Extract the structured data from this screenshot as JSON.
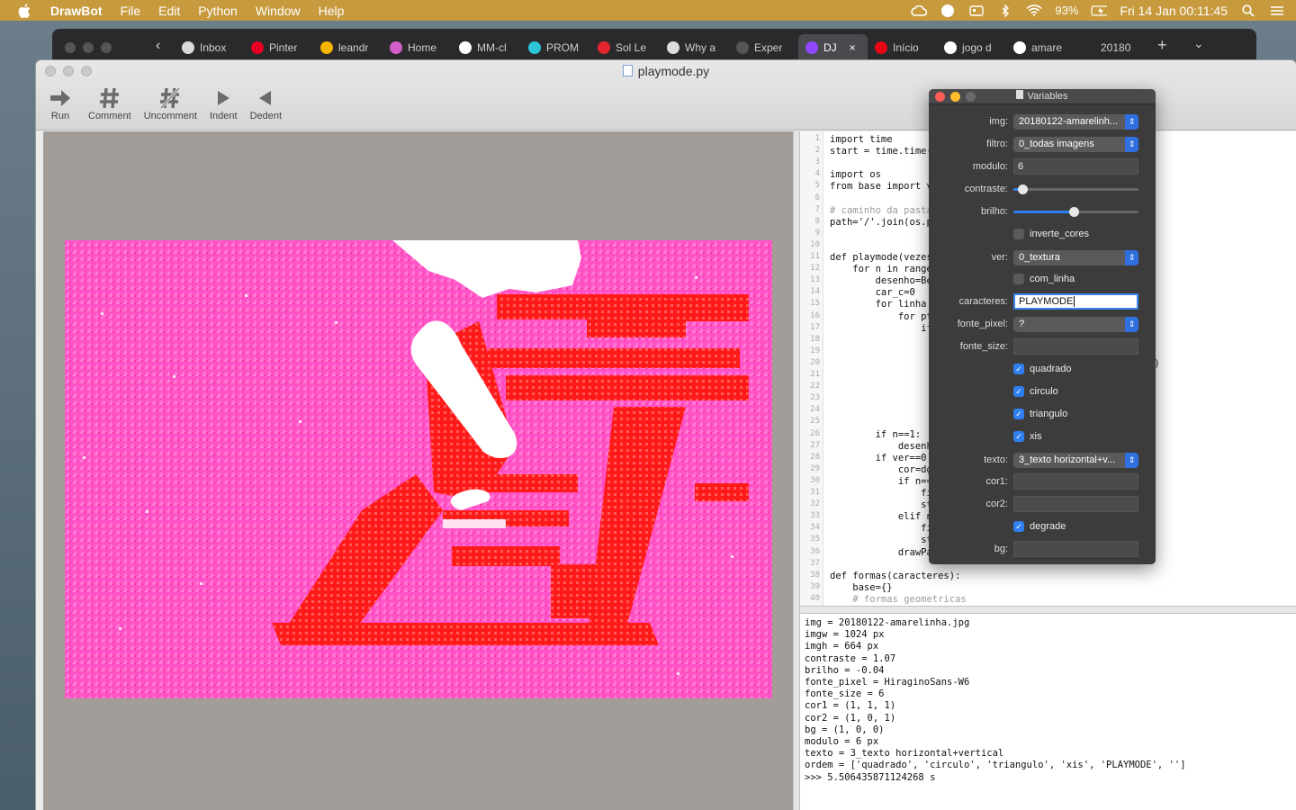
{
  "menubar": {
    "app": "DrawBot",
    "items": [
      "File",
      "Edit",
      "Python",
      "Window",
      "Help"
    ],
    "battery": "93%",
    "clock": "Fri 14 Jan  00:11:45"
  },
  "browser": {
    "tabs": [
      {
        "label": "Inbox",
        "color": "#d9d9d9"
      },
      {
        "label": "Pinter",
        "color": "#e60023"
      },
      {
        "label": "leandr",
        "color": "#f4b400"
      },
      {
        "label": "Home",
        "color": "#d35ec7"
      },
      {
        "label": "MM-cl",
        "color": "#ffffff"
      },
      {
        "label": "PROM",
        "color": "#2ec4d8"
      },
      {
        "label": "Sol Le",
        "color": "#e3262e"
      },
      {
        "label": "Why a",
        "color": "#dddddd"
      },
      {
        "label": "Exper",
        "color": "#555555"
      },
      {
        "label": "DJ",
        "color": "#9147ff"
      },
      {
        "label": "Início",
        "color": "#e50914"
      },
      {
        "label": "jogo d",
        "color": "#ffffff"
      },
      {
        "label": "amare",
        "color": "#ffffff"
      },
      {
        "label": "20180",
        "color": "#2a2a2c"
      }
    ],
    "active_tab_index": 9
  },
  "window": {
    "title": "playmode.py",
    "toolbar": [
      {
        "label": "Run",
        "icon": "run-arrow-icon",
        "glyph": "➜"
      },
      {
        "label": "Comment",
        "icon": "hash-icon",
        "glyph": "#"
      },
      {
        "label": "Uncomment",
        "icon": "hash-strike-icon",
        "glyph": "#̸"
      },
      {
        "label": "Indent",
        "icon": "indent-triangle-icon",
        "glyph": "▶"
      },
      {
        "label": "Dedent",
        "icon": "dedent-triangle-icon",
        "glyph": "◀"
      }
    ]
  },
  "code": {
    "line_numbers": [
      "1",
      "2",
      "3",
      "4",
      "5",
      "6",
      "7",
      "8",
      "9",
      "10",
      "11",
      "12",
      "13",
      "14",
      "15",
      "16",
      "17",
      "18",
      "19",
      "20",
      "21",
      "22",
      "23",
      "24",
      "25",
      "26",
      "27",
      "28",
      "29",
      "30",
      "31",
      "32",
      "33",
      "34",
      "35",
      "36",
      "37",
      "38",
      "39",
      "40"
    ],
    "lines": [
      "import time",
      "start = time.time(",
      "",
      "import os",
      "from base import va",
      "",
      "# caminho da pasta",
      "path='/'.join(os.pa",
      "",
      "",
      "def playmode(vezes",
      "    for n in range",
      "        desenho=Bez",
      "        car_c=0",
      "        for linha i",
      "            for pt",
      "                if",
      "",
      "",
      "                                       desenho,base,texto)",
      "",
      "",
      "                                       esenho,base,texto)",
      "",
      "                                       ho,base,texto)",
      "        if n==1:",
      "            desenh",
      "        if ver==0:",
      "            cor=dgr",
      "            if n==",
      "                fi",
      "                st",
      "            elif n",
      "                fi",
      "                st",
      "            drawPat",
      "",
      "def formas(caracteres):",
      "    base={}",
      "    # formas geometricas"
    ]
  },
  "output": {
    "lines": [
      "img = 20180122-amarelinha.jpg",
      "imgw = 1024 px",
      "imgh = 664 px",
      "contraste = 1.07",
      "brilho = -0.04",
      "fonte_pixel = HiraginoSans-W6",
      "fonte_size = 6",
      "cor1 = (1, 1, 1)",
      "cor2 = (1, 0, 1)",
      "bg = (1, 0, 0)",
      "modulo = 6 px",
      "texto = 3_texto horizontal+vertical",
      "ordem = ['quadrado', 'circulo', 'triangulo', 'xis', 'PLAYMODE', '']",
      "",
      ">>> 5.506435871124268 s"
    ]
  },
  "variables": {
    "title": "Variables",
    "img": {
      "label": "img:",
      "value": "20180122-amarelinh..."
    },
    "filtro": {
      "label": "filtro:",
      "value": "0_todas imagens"
    },
    "modulo": {
      "label": "modulo:",
      "value": "6"
    },
    "contraste": {
      "label": "contraste:",
      "fraction": 0.07
    },
    "brilho": {
      "label": "brilho:",
      "fraction": 0.48
    },
    "inverte_cores": {
      "label": "inverte_cores",
      "checked": false
    },
    "ver": {
      "label": "ver:",
      "value": "0_textura"
    },
    "com_linha": {
      "label": "com_linha",
      "checked": false
    },
    "caracteres": {
      "label": "caracteres:",
      "value": "PLAYMODE"
    },
    "fonte_pixel": {
      "label": "fonte_pixel:",
      "value": "?"
    },
    "fonte_size": {
      "label": "fonte_size:",
      "value": ""
    },
    "quadrado": {
      "label": "quadrado",
      "checked": true
    },
    "circulo": {
      "label": "circulo",
      "checked": true
    },
    "triangulo": {
      "label": "triangulo",
      "checked": true
    },
    "xis": {
      "label": "xis",
      "checked": true
    },
    "texto": {
      "label": "texto:",
      "value": "3_texto horizontal+v..."
    },
    "cor1": {
      "label": "cor1:",
      "value": ""
    },
    "cor2": {
      "label": "cor2:",
      "value": ""
    },
    "degrade": {
      "label": "degrade",
      "checked": true
    },
    "bg": {
      "label": "bg:",
      "value": ""
    }
  },
  "colors": {
    "menubar": "#c89a3e",
    "canvas_bg": "#a29d98",
    "art_pink": "#ff48c0",
    "art_red": "#ff1a1a",
    "accent": "#2f7ff0"
  }
}
